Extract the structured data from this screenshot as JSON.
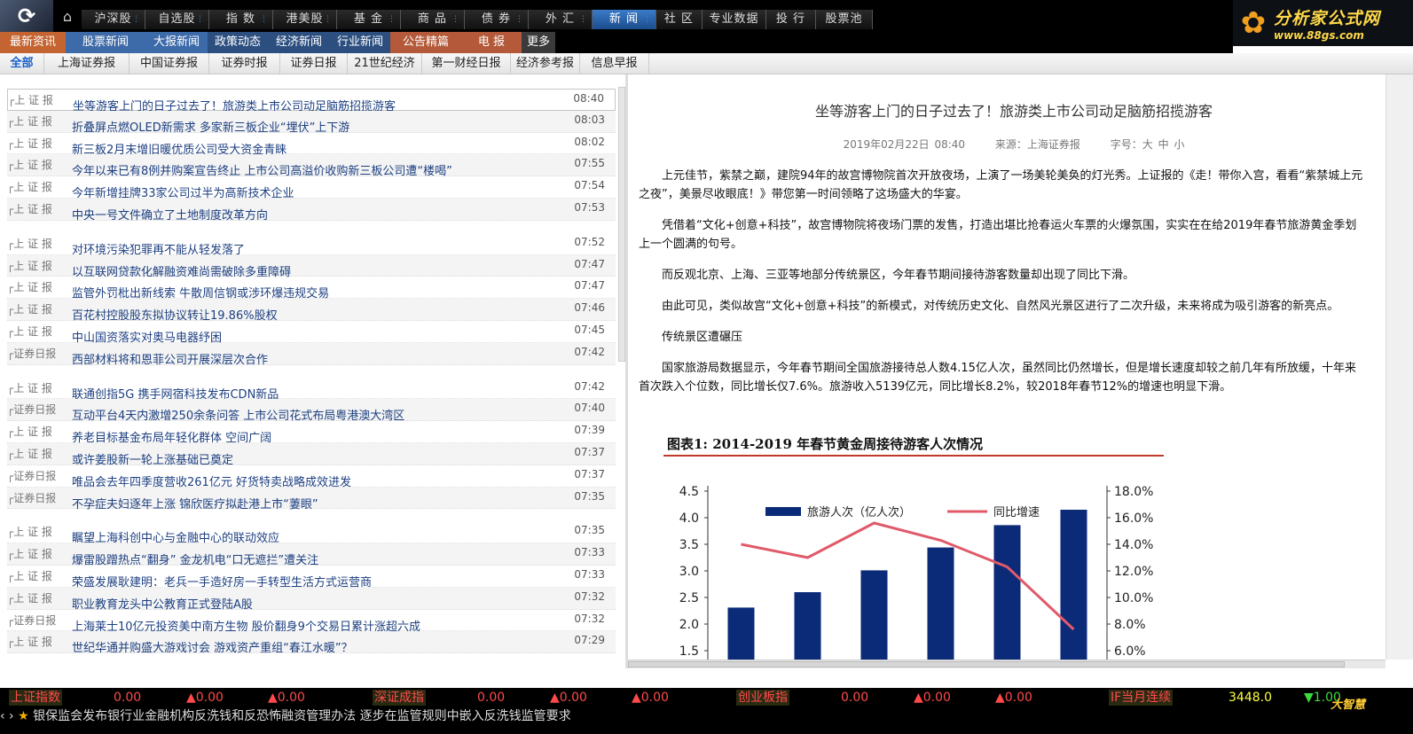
{
  "topnav": {
    "items": [
      "沪深股",
      "自选股",
      "指 数",
      "港美股",
      "基 金",
      "商 品",
      "债 券",
      "外 汇",
      "新 闻",
      "社 区",
      "专业数据",
      "投 行",
      "股票池"
    ],
    "active_index": 8
  },
  "brand": {
    "name": "分析家公式网",
    "url": "www.88gs.com"
  },
  "subnav": {
    "items": [
      "最新资讯",
      "股票新闻",
      "大报新闻",
      "政策动态",
      "经济新闻",
      "行业新闻",
      "公告精篇",
      "电 报",
      "更多"
    ]
  },
  "tabs": {
    "items": [
      "全部",
      "上海证券报",
      "中国证券报",
      "证券时报",
      "证券日报",
      "21世纪经济",
      "第一财经日报",
      "经济参考报",
      "信息早报"
    ],
    "active_index": 0
  },
  "news": [
    {
      "src": "上 证 报",
      "title": "坐等游客上门的日子过去了！旅游类上市公司动足脑筋招揽游客",
      "time": "08:40"
    },
    {
      "src": "上 证 报",
      "title": "折叠屏点燃OLED新需求 多家新三板企业“埋伏”上下游",
      "time": "08:03"
    },
    {
      "src": "上 证 报",
      "title": "新三板2月末增旧暖优质公司受大资金青睐",
      "time": "08:02"
    },
    {
      "src": "上 证 报",
      "title": "今年以来已有8例并购案宣告终止 上市公司高溢价收购新三板公司遭“楼喝”",
      "time": "07:55"
    },
    {
      "src": "上 证 报",
      "title": "今年新增挂牌33家公司过半为高新技术企业",
      "time": "07:54"
    },
    {
      "src": "上 证 报",
      "title": "中央一号文件确立了土地制度改革方向",
      "time": "07:53"
    },
    {
      "src": "上 证 报",
      "title": "对环境污染犯罪再不能从轻发落了",
      "time": "07:52"
    },
    {
      "src": "上 证 报",
      "title": "以互联网贷款化解融资难尚需破除多重障碍",
      "time": "07:47"
    },
    {
      "src": "上 证 报",
      "title": "监管外罚枇出新线索 牛散周信钢或涉环爆违规交易",
      "time": "07:47"
    },
    {
      "src": "上 证 报",
      "title": "百花村控股股东拟协议转让19.86%股权",
      "time": "07:46"
    },
    {
      "src": "上 证 报",
      "title": "中山国资落实对奥马电器纾困",
      "time": "07:45"
    },
    {
      "src": "证券日报",
      "title": "西部材料将和恩菲公司开展深层次合作",
      "time": "07:42"
    },
    {
      "src": "上 证 报",
      "title": "联通创指5G 携手网宿科技发布CDN新品",
      "time": "07:42"
    },
    {
      "src": "证券日报",
      "title": "互动平台4天内激增250余条问答 上市公司花式布局粤港澳大湾区",
      "time": "07:40"
    },
    {
      "src": "上 证 报",
      "title": "养老目标基金布局年轻化群体 空间广阔",
      "time": "07:39"
    },
    {
      "src": "上 证 报",
      "title": "或许姜股新一轮上涨基础已奠定",
      "time": "07:37"
    },
    {
      "src": "证券日报",
      "title": "唯品会去年四季度营收261亿元 好货特卖战略成效进发",
      "time": "07:37"
    },
    {
      "src": "证券日报",
      "title": "不孕症夫妇逐年上涨 锦欣医疗拟赴港上市“萋眼”",
      "time": "07:35"
    },
    {
      "src": "上 证 报",
      "title": "瞩望上海科创中心与金融中心的联动效应",
      "time": "07:35"
    },
    {
      "src": "上 证 报",
      "title": "爆雷股蹭热点“翻身” 金龙机电“口无遮拦”遭关注",
      "time": "07:33"
    },
    {
      "src": "上 证 报",
      "title": "荣盛发展耿建明：老兵一手造好房一手转型生活方式运营商",
      "time": "07:33"
    },
    {
      "src": "上 证 报",
      "title": "职业教育龙头中公教育正式登陆A股",
      "time": "07:32"
    },
    {
      "src": "证券日报",
      "title": "上海莱士10亿元投资美中南方生物 股价翻身9个交易日累计涨超六成",
      "time": "07:32"
    },
    {
      "src": "上 证 报",
      "title": "世纪华通并购盛大游戏讨会 游戏资产重组“春江水暖”？",
      "time": "07:29"
    }
  ],
  "article": {
    "title": "坐等游客上门的日子过去了！旅游类上市公司动足脑筋招揽游客",
    "datetime": "2019年02月22日 08:40",
    "source": "来源：上海证券报",
    "fontsize": "字号：大 中 小",
    "paragraphs": [
      "上元佳节，紫禁之巅，建院94年的故宫博物院首次开放夜场，上演了一场美轮美奂的灯光秀。上证报的《走！带你入宫，看看“紫禁城上元之夜”，美景尽收眼底！》带您第一时间领略了这场盛大的华宴。",
      "凭借着“文化+创意+科技”，故宫博物院将夜场门票的发售，打造出堪比抢春运火车票的火爆氛围，实实在在给2019年春节旅游黄金季划上一个圆满的句号。",
      "而反观北京、上海、三亚等地部分传统景区，今年春节期间接待游客数量却出现了同比下滑。",
      "由此可见，类似故宫“文化+创意+科技”的新模式，对传统历史文化、自然风光景区进行了二次升级，未来将成为吸引游客的新亮点。",
      "传统景区遭碾压",
      "国家旅游局数据显示，今年春节期间全国旅游接待总人数4.15亿人次，虽然同比仍然增长，但是增长速度却较之前几年有所放缓，十年来首次跌入个位数，同比增长仅7.6%。旅游收入5139亿元，同比增长8.2%，较2018年春节12%的增速也明显下滑。"
    ]
  },
  "chart_data": {
    "type": "bar",
    "title": "图表1:   2014-2019 年春节黄金周接待游客人次情况",
    "series": [
      {
        "name": "旅游人次（亿人次）",
        "values": [
          2.31,
          2.6,
          3.01,
          3.44,
          3.86,
          4.15
        ],
        "color": "#0b2a78",
        "axis": "left"
      },
      {
        "name": "同比增速",
        "values": [
          14.0,
          13.0,
          15.6,
          14.3,
          12.3,
          7.6
        ],
        "color": "#e05a6a",
        "axis": "right"
      }
    ],
    "y_left_ticks": [
      "4.5",
      "4.0",
      "3.5",
      "3.0",
      "2.5",
      "2.0",
      "1.5"
    ],
    "y_right_ticks": [
      "18.0%",
      "16.0%",
      "14.0%",
      "12.0%",
      "10.0%",
      "8.0%",
      "6.0%"
    ],
    "ylim_left": [
      1.5,
      4.5
    ],
    "ylim_right": [
      6.0,
      18.0
    ]
  },
  "ticker": {
    "items": [
      {
        "name": "上证指数",
        "v1": "0.00",
        "v2": "▲0.00",
        "v3": "▲0.00"
      },
      {
        "name": "深证成指",
        "v1": "0.00",
        "v2": "▲0.00",
        "v3": "▲0.00"
      },
      {
        "name": "创业板指",
        "v1": "0.00",
        "v2": "▲0.00",
        "v3": "▲0.00"
      }
    ],
    "futures": {
      "name": "IF当月连续",
      "v1": "3448.0",
      "v2": "▼1.00"
    },
    "scroll_text": "银保监会发布银行业金融机构反洗钱和反恐怖融资管理办法 逐步在监管规则中嵌入反洗钱监管要求",
    "brand": "大智慧"
  },
  "colors": {
    "accent": "#1b4d8c",
    "link": "#1c3f80",
    "up": "#ff4a4a"
  }
}
